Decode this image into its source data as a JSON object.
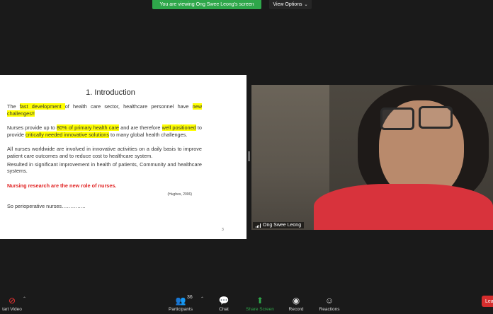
{
  "banner": {
    "viewing_text": "You are viewing Ong Swee Leong's screen"
  },
  "view_options": {
    "label": "View Options",
    "caret": "⌄"
  },
  "slide": {
    "title": "1. Introduction",
    "p1_a": "The ",
    "p1_hl1": "fast development ",
    "p1_b": "of health care sector, healthcare personnel have ",
    "p1_hl2": "new challenges!!",
    "p2_a": "Nurses provide up to ",
    "p2_hl1": "80% of primary health care",
    "p2_b": " and are therefore ",
    "p2_hl2": "well positioned",
    "p2_c": " to provide ",
    "p2_hl3": "critically needed innovative solutions",
    "p2_d": " to many global health challenges.",
    "p3": "All nurses worldwide are involved in innovative activities on a daily basis to improve patient care outcomes and to reduce cost to healthcare system.",
    "p4": "Resulted in significant improvement in health of patients, Community and healthcare systems.",
    "red_line": "Nursing research are the new role of nurses.",
    "citation": "(Hughes, 2006)",
    "last_line": "So perioperative nurses…………..",
    "page_number": "3"
  },
  "video": {
    "participant_name": "Ong Swee Leong"
  },
  "toolbar": {
    "start_video": "tart Video",
    "participants": "Participants",
    "participant_count": "36",
    "chat": "Chat",
    "share_screen": "Share Screen",
    "record": "Record",
    "reactions": "Reactions",
    "leave": "Lea"
  },
  "colors": {
    "share_green": "#2ea74a",
    "highlight": "#ffff00",
    "leave_red": "#d62d2d"
  }
}
